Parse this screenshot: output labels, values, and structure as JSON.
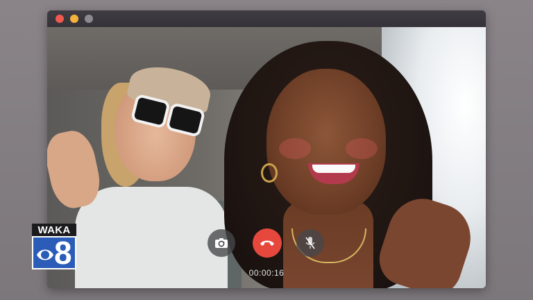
{
  "window": {
    "controls": {
      "close_color": "#f05a4e",
      "minimize_color": "#f4b23c",
      "maximize_color": "#8c8990"
    }
  },
  "call": {
    "timer": "00:00:16",
    "end_call_color": "#e6483e",
    "buttons": {
      "camera_icon": "camera-flip-icon",
      "end_icon": "phone-hangup-icon",
      "mic_icon": "mic-off-icon"
    }
  },
  "logo": {
    "callsign": "WAKA",
    "channel": "8",
    "brand_color": "#2b5cb8"
  }
}
